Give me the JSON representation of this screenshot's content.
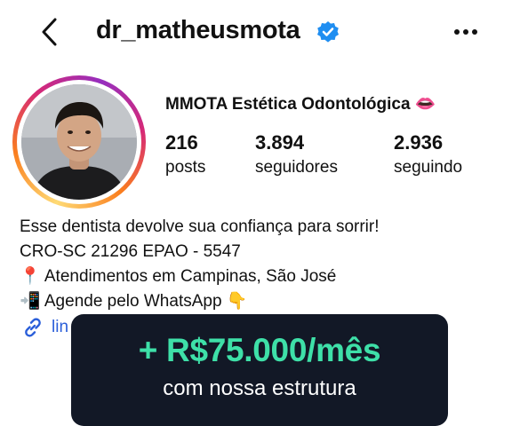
{
  "header": {
    "username": "dr_matheusmota",
    "icons": {
      "back": "chevron-left-icon",
      "verified": "verified-badge-icon",
      "more": "more-horizontal-icon"
    },
    "verified_color": "#1f8ef1"
  },
  "profile": {
    "display_name": "MMOTA Estética Odontológica 👄",
    "stats": [
      {
        "value": "216",
        "label": "posts"
      },
      {
        "value": "3.894",
        "label": "seguidores"
      },
      {
        "value": "2.936",
        "label": "seguindo"
      }
    ]
  },
  "bio": {
    "lines": [
      "Esse dentista devolve sua confiança para sorrir!",
      "CRO-SC 21296 EPAO - 5547",
      "📍 Atendimentos em Campinas, São José",
      "📲 Agende pelo WhatsApp 👇"
    ],
    "link_text": "lin"
  },
  "promo": {
    "amount": "+ R$75.000/mês",
    "subtitle": "com nossa estrutura",
    "accent_color": "#3ee0a8",
    "background": "#121826"
  }
}
